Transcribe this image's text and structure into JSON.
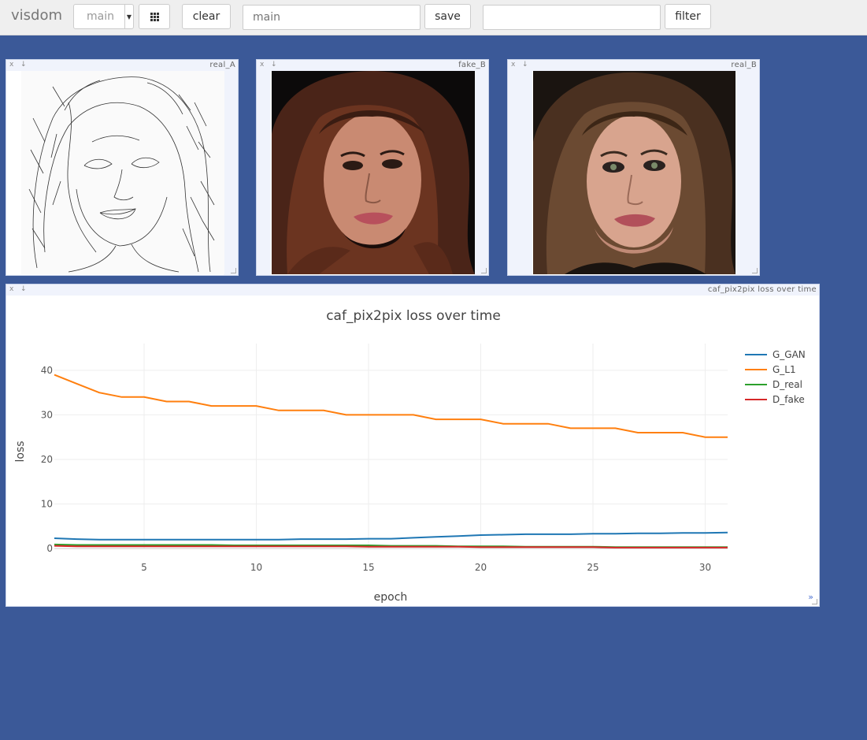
{
  "header": {
    "brand": "visdom",
    "env_select_value": "main",
    "clear_label": "clear",
    "env_input_placeholder": "main",
    "save_label": "save",
    "filter_input_value": "",
    "filter_label": "filter"
  },
  "panes": [
    {
      "title": "real_A",
      "close": "x",
      "download": "↓",
      "kind": "edge-sketch"
    },
    {
      "title": "fake_B",
      "close": "x",
      "download": "↓",
      "kind": "generated-portrait"
    },
    {
      "title": "real_B",
      "close": "x",
      "download": "↓",
      "kind": "photo-portrait"
    }
  ],
  "chart_pane": {
    "title": "caf_pix2pix loss over time",
    "close": "x",
    "download": "↓",
    "more": "»"
  },
  "colors": {
    "background": "#3b5998",
    "G_GAN": "#1f77b4",
    "G_L1": "#ff7f0e",
    "D_real": "#2ca02c",
    "D_fake": "#d62728"
  },
  "chart_data": {
    "type": "line",
    "title": "caf_pix2pix loss over time",
    "xlabel": "epoch",
    "ylabel": "loss",
    "xlim": [
      1,
      31
    ],
    "ylim": [
      0,
      46
    ],
    "xticks": [
      5,
      10,
      15,
      20,
      25,
      30
    ],
    "yticks": [
      0,
      10,
      20,
      30,
      40
    ],
    "grid": true,
    "legend_position": "top-right",
    "series": [
      {
        "name": "G_GAN",
        "color": "#1f77b4",
        "x": [
          1,
          2,
          3,
          4,
          5,
          6,
          7,
          8,
          9,
          10,
          11,
          12,
          13,
          14,
          15,
          16,
          17,
          18,
          19,
          20,
          21,
          22,
          23,
          24,
          25,
          26,
          27,
          28,
          29,
          30,
          31
        ],
        "y": [
          2.3,
          2.1,
          2.0,
          2.0,
          2.0,
          2.0,
          2.0,
          2.0,
          2.0,
          2.0,
          2.0,
          2.1,
          2.1,
          2.1,
          2.2,
          2.2,
          2.4,
          2.6,
          2.8,
          3.0,
          3.1,
          3.2,
          3.2,
          3.2,
          3.3,
          3.3,
          3.4,
          3.4,
          3.5,
          3.5,
          3.6
        ]
      },
      {
        "name": "G_L1",
        "color": "#ff7f0e",
        "x": [
          1,
          2,
          3,
          4,
          5,
          6,
          7,
          8,
          9,
          10,
          11,
          12,
          13,
          14,
          15,
          16,
          17,
          18,
          19,
          20,
          21,
          22,
          23,
          24,
          25,
          26,
          27,
          28,
          29,
          30,
          31
        ],
        "y": [
          39,
          37,
          35,
          34,
          34,
          33,
          33,
          32,
          32,
          32,
          31,
          31,
          31,
          30,
          30,
          30,
          30,
          29,
          29,
          29,
          28,
          28,
          28,
          27,
          27,
          27,
          26,
          26,
          26,
          25,
          25
        ]
      },
      {
        "name": "D_real",
        "color": "#2ca02c",
        "x": [
          1,
          2,
          3,
          4,
          5,
          6,
          7,
          8,
          9,
          10,
          11,
          12,
          13,
          14,
          15,
          16,
          17,
          18,
          19,
          20,
          21,
          22,
          23,
          24,
          25,
          26,
          27,
          28,
          29,
          30,
          31
        ],
        "y": [
          0.9,
          0.8,
          0.8,
          0.8,
          0.8,
          0.8,
          0.8,
          0.8,
          0.7,
          0.7,
          0.7,
          0.7,
          0.7,
          0.7,
          0.7,
          0.6,
          0.6,
          0.6,
          0.5,
          0.5,
          0.5,
          0.4,
          0.4,
          0.4,
          0.4,
          0.3,
          0.3,
          0.3,
          0.3,
          0.3,
          0.3
        ]
      },
      {
        "name": "D_fake",
        "color": "#d62728",
        "x": [
          1,
          2,
          3,
          4,
          5,
          6,
          7,
          8,
          9,
          10,
          11,
          12,
          13,
          14,
          15,
          16,
          17,
          18,
          19,
          20,
          21,
          22,
          23,
          24,
          25,
          26,
          27,
          28,
          29,
          30,
          31
        ],
        "y": [
          0.6,
          0.5,
          0.5,
          0.5,
          0.5,
          0.5,
          0.5,
          0.5,
          0.5,
          0.5,
          0.5,
          0.5,
          0.5,
          0.5,
          0.4,
          0.4,
          0.4,
          0.4,
          0.4,
          0.3,
          0.3,
          0.3,
          0.3,
          0.3,
          0.3,
          0.2,
          0.2,
          0.2,
          0.2,
          0.2,
          0.2
        ]
      }
    ]
  }
}
